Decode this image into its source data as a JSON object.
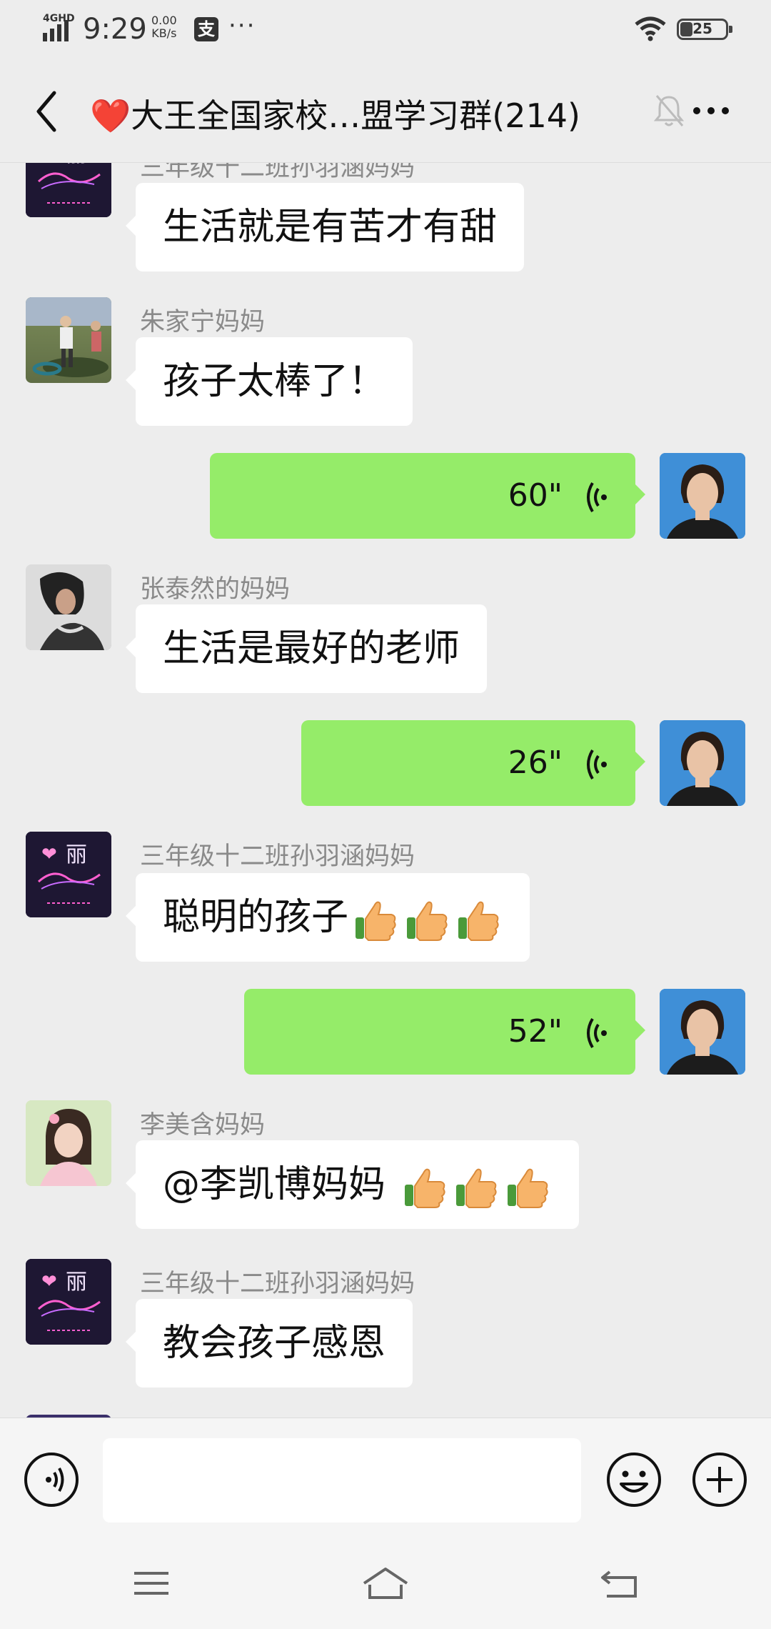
{
  "status_bar": {
    "network": "4GHD",
    "time": "9:29",
    "speed_value": "0.00",
    "speed_unit": "KB/s",
    "app_badge": "支",
    "more": "···",
    "battery": "25",
    "battery_level": 0.25
  },
  "header": {
    "title": "❤️大王全国家校…盟学习群(214)"
  },
  "messages": [
    {
      "type": "text",
      "side": "left",
      "sender": "三年级十二班孙羽涵妈妈",
      "text": "生活就是有苦才有甜",
      "avatar": "neon-avatar"
    },
    {
      "type": "text",
      "side": "left",
      "sender": "朱家宁妈妈",
      "text": "孩子太棒了！",
      "avatar": "outdoor-avatar"
    },
    {
      "type": "voice",
      "side": "right",
      "duration": "60\"",
      "avatar": "self-avatar"
    },
    {
      "type": "text",
      "side": "left",
      "sender": "张泰然的妈妈",
      "text": "生活是最好的老师",
      "avatar": "woman-avatar"
    },
    {
      "type": "voice",
      "side": "right",
      "duration": "26\"",
      "avatar": "self-avatar"
    },
    {
      "type": "text",
      "side": "left",
      "sender": "三年级十二班孙羽涵妈妈",
      "text": "聪明的孩子",
      "emoji": "thumbs-up-icon",
      "emoji_count": 3,
      "avatar": "neon-avatar"
    },
    {
      "type": "voice",
      "side": "right",
      "duration": "52\"",
      "avatar": "self-avatar"
    },
    {
      "type": "text",
      "side": "left",
      "sender": "李美含妈妈",
      "text": "@李凯博妈妈 ",
      "emoji": "thumbs-up-icon",
      "emoji_count": 3,
      "avatar": "girl-avatar"
    },
    {
      "type": "text",
      "side": "left",
      "sender": "三年级十二班孙羽涵妈妈",
      "text": "教会孩子感恩",
      "avatar": "neon-avatar"
    }
  ],
  "neon_avatar": {
    "heart": "❤",
    "char": "丽"
  },
  "input_bar": {
    "placeholder": ""
  },
  "colors": {
    "background": "#ededed",
    "voice_bubble": "#95ec69",
    "text_bubble": "#ffffff",
    "sender_name": "#8a8a8a"
  }
}
